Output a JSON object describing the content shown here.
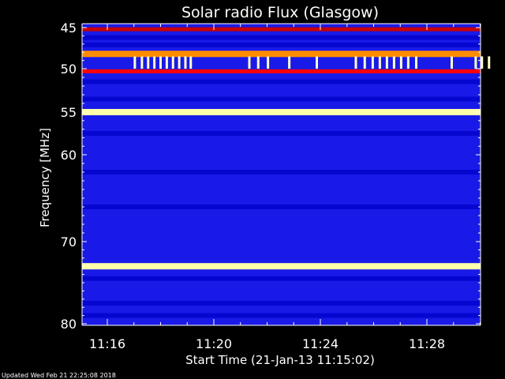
{
  "chart_data": {
    "type": "heatmap",
    "title": "Solar radio Flux (Glasgow)",
    "ylabel": "Frequency [MHz]",
    "xlabel": "Start Time (21-Jan-13 11:15:02)",
    "y_ticks": [
      {
        "value": 45,
        "label": "45"
      },
      {
        "value": 50,
        "label": "50"
      },
      {
        "value": 55,
        "label": "55"
      },
      {
        "value": 60,
        "label": "60"
      },
      {
        "value": 70,
        "label": "70"
      },
      {
        "value": 80,
        "label": "80"
      }
    ],
    "x_ticks": [
      {
        "value": "11:16",
        "label": "11:16"
      },
      {
        "value": "11:20",
        "label": "11:20"
      },
      {
        "value": "11:24",
        "label": "11:24"
      },
      {
        "value": "11:28",
        "label": "11:28"
      }
    ],
    "time_range": [
      "11:15:02",
      "11:30:40"
    ],
    "freq_range_mhz": [
      45,
      80
    ],
    "frequency_axis_scale": "inverted, compressed toward higher frequency",
    "background_color": "#1a1ae8",
    "colormap": [
      "#0000c8",
      "#1a1ae8",
      "#c80000",
      "#ff0000",
      "#ff8c00",
      "#ffff00",
      "#ffffff"
    ],
    "bands": [
      {
        "freq_mhz": 45.2,
        "intensity": "high",
        "color": "#c80000"
      },
      {
        "freq_mhz": 48.2,
        "intensity": "very-high",
        "color": "#ff8c00"
      },
      {
        "freq_mhz": 50.3,
        "intensity": "high",
        "color": "#ff0000"
      },
      {
        "freq_mhz": 55.0,
        "intensity": "very-high",
        "color": "#ffffaa"
      },
      {
        "freq_mhz": 73.0,
        "intensity": "very-high",
        "color": "#ffffaa"
      }
    ],
    "pulse_band": {
      "freq_range_mhz": [
        48.5,
        50.0
      ],
      "times": [
        "11:17:02",
        "11:17:18",
        "11:17:32",
        "11:17:46",
        "11:18:00",
        "11:18:14",
        "11:18:28",
        "11:18:42",
        "11:18:56",
        "11:19:08",
        "11:21:20",
        "11:21:40",
        "11:22:02",
        "11:22:50",
        "11:23:52",
        "11:25:20",
        "11:25:40",
        "11:25:58",
        "11:26:14",
        "11:26:30",
        "11:26:46",
        "11:27:02",
        "11:27:18",
        "11:27:36",
        "11:28:56",
        "11:29:50",
        "11:30:04",
        "11:30:20"
      ]
    },
    "grid": false
  },
  "footer": {
    "updated": "Updated Wed Feb 21 22:25:08 2018"
  }
}
